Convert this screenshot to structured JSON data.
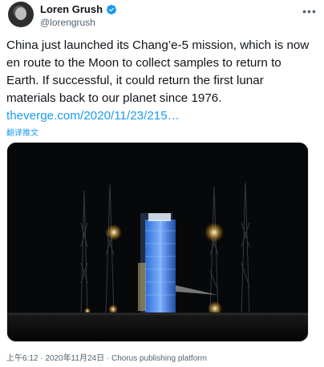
{
  "author": {
    "name": "Loren Grush",
    "handle": "@lorengrush"
  },
  "tweet": {
    "text": "China just launched its Chang’e-5 mission, which is now en route to the Moon to collect samples to return to Earth. If successful, it could return the first lunar materials back to our planet since 1976.",
    "link_text": "theverge.com/2020/11/23/215…",
    "translate_label": "翻译推文"
  },
  "meta": {
    "timestamp": "上午6:12 · 2020年11月24日 · Chorus publishing platform"
  },
  "icons": {
    "verified": "verified-badge-icon",
    "more": "more-options-icon"
  },
  "colors": {
    "link": "#1d9bf0",
    "secondary": "#536471",
    "verified": "#1d9bf0"
  }
}
